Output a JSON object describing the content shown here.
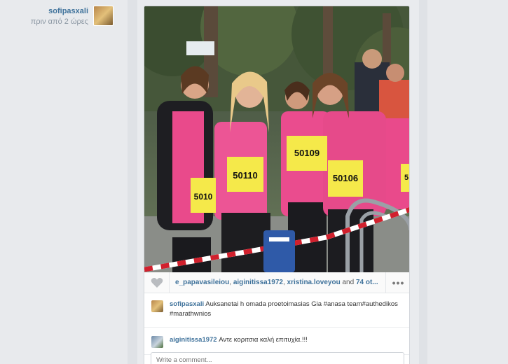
{
  "author": {
    "username": "sofipasxali",
    "time_ago": "πριν από 2 ώρες"
  },
  "likes": {
    "user1": "e_papavasileiou",
    "user2": "aiginitissa1972",
    "user3": "xristina.loveyou",
    "and_text": "and",
    "others": "74 ot..."
  },
  "more_label": "•••",
  "comments": [
    {
      "username": "sofipasxali",
      "text": "Auksanetai h omada proetoimasias Gia #anasa team#authedikos #marathwnios"
    },
    {
      "username": "aiginitissa1972",
      "text": "Αντε κοριτσια καλή επιτυχία.!!!"
    }
  ],
  "comment_input": {
    "placeholder": "Write a comment..."
  },
  "bibs": [
    "5010",
    "50110",
    "50109",
    "50106",
    "5"
  ],
  "colors": {
    "link": "#3f729b",
    "shirt_pink": "#e94a8b"
  }
}
